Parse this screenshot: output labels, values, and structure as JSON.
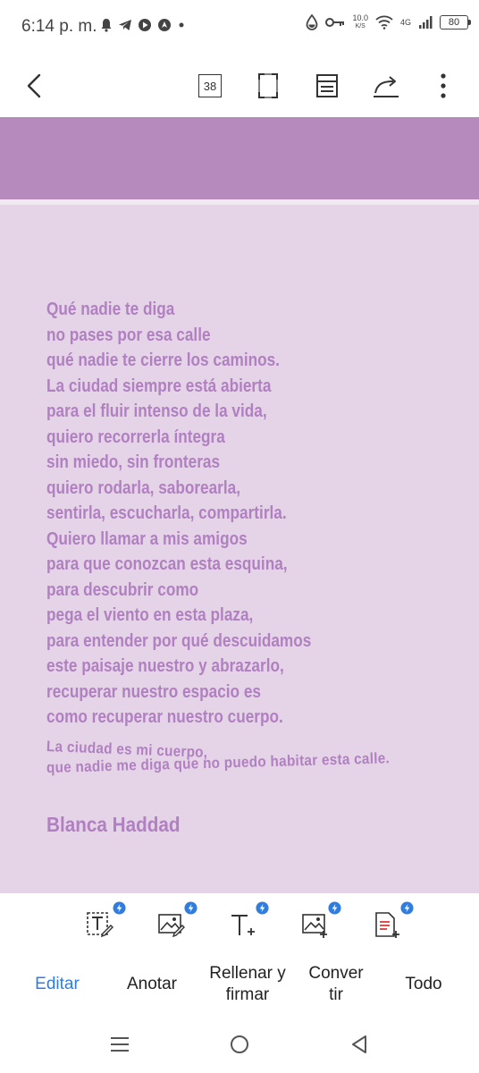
{
  "status_bar": {
    "time": "6:14 p. m.",
    "net_speed_value": "10.0",
    "net_speed_unit": "K/S",
    "network": "4G",
    "battery": "80",
    "icons_left": [
      "bell-icon",
      "telegram-icon",
      "play-icon",
      "compass-icon",
      "dot-icon"
    ],
    "icons_right": [
      "drop-icon",
      "key-icon",
      "wifi-icon",
      "signal-icon",
      "battery-icon"
    ]
  },
  "toolbar": {
    "page_count": "38",
    "buttons": [
      "back-icon",
      "page-count",
      "fullscreen-icon",
      "reading-mode-icon",
      "share-icon",
      "more-icon"
    ]
  },
  "document": {
    "header_color": "#b78abd",
    "page_color": "#e5d3e7",
    "text_color": "#b080c0",
    "poem_lines": [
      "Qué nadie te diga",
      "no pases por esa calle",
      "qué nadie te cierre los caminos.",
      "La ciudad siempre está abierta",
      "para el fluir intenso de la vida,",
      "quiero recorrerla íntegra",
      "sin miedo, sin fronteras",
      "quiero rodarla, saborearla,",
      "sentirla, escucharla, compartirla.",
      "Quiero llamar a mis amigos",
      "para que conozcan esta esquina,",
      "para descubrir como",
      "pega el viento en esta plaza,",
      "para entender por qué descuidamos",
      "este paisaje nuestro y abrazarlo,",
      "recuperar nuestro espacio es",
      "como recuperar nuestro cuerpo."
    ],
    "curved_line_1": "La ciudad es mi cuerpo,",
    "curved_line_2": "que nadie me diga que no puedo habitar esta calle.",
    "author": "Blanca Haddad"
  },
  "tools": [
    {
      "name": "edit-text-tool-icon"
    },
    {
      "name": "edit-image-tool-icon"
    },
    {
      "name": "add-text-tool-icon"
    },
    {
      "name": "add-image-tool-icon"
    },
    {
      "name": "convert-pdf-tool-icon"
    }
  ],
  "bottom_nav": {
    "tab_editar": "Editar",
    "tab_anotar": "Anotar",
    "tab_rellenar_1": "Rellenar y",
    "tab_rellenar_2": "firmar",
    "tab_convertir_1": "Conver",
    "tab_convertir_2": "tir",
    "tab_todo": "Todo",
    "active_color": "#2f7de1"
  },
  "system_nav": [
    "recents-icon",
    "home-icon",
    "back-triangle-icon"
  ]
}
